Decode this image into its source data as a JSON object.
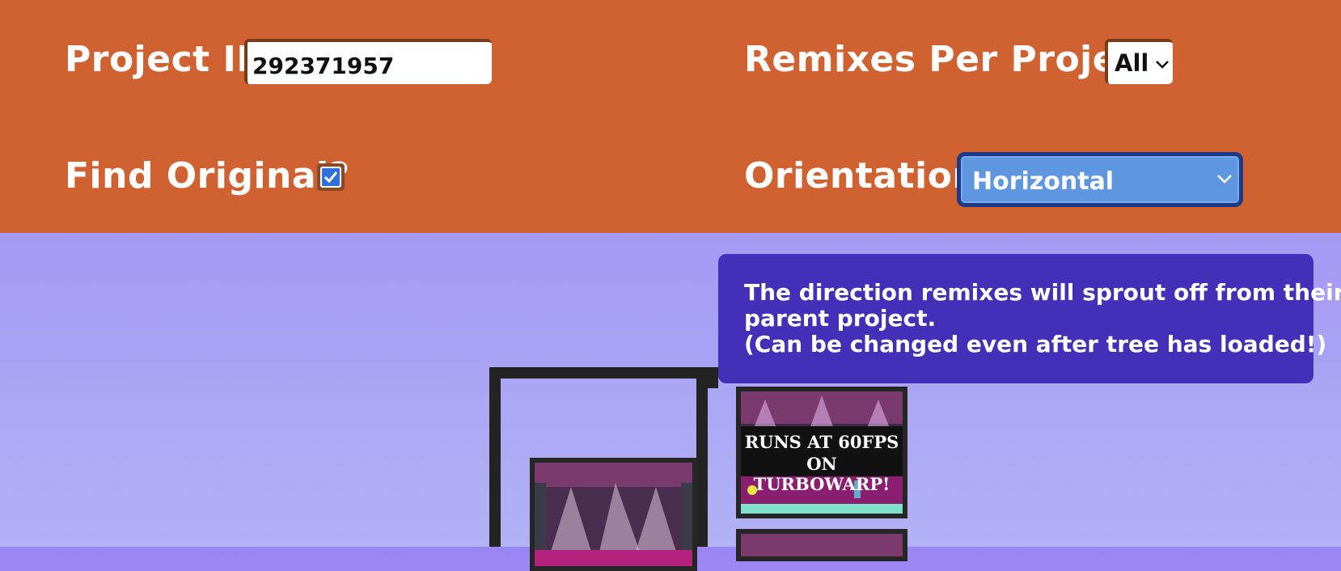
{
  "settings": {
    "project_id_label": "Project ID:",
    "project_id_value": "292371957",
    "remixes_label": "Remixes Per Project:",
    "remixes_value": "All",
    "find_original_label": "Find Original?",
    "find_original_checked": true,
    "orientation_label": "Orientation:",
    "orientation_value": "Horizontal"
  },
  "tooltip": {
    "line1": "The direction remixes will sprout off from their",
    "line2": "parent project.",
    "line3": "(Can be changed even after tree has loaded!)"
  },
  "tree": {
    "thumb_top_text_line1": "RUNS AT 60FPS",
    "thumb_top_text_line2": "ON TURBOWARP!"
  },
  "colors": {
    "header_bg": "#d06231",
    "page_gradient_top": "#9a86f3",
    "page_gradient_bottom": "#b2b2f5",
    "tooltip_bg": "#4430b8",
    "select_bg": "#5e96e0"
  },
  "icons": {
    "small_select_chevron": "chevron-down-icon",
    "big_select_chevron": "chevron-down-icon",
    "checkbox_check": "check-icon"
  }
}
